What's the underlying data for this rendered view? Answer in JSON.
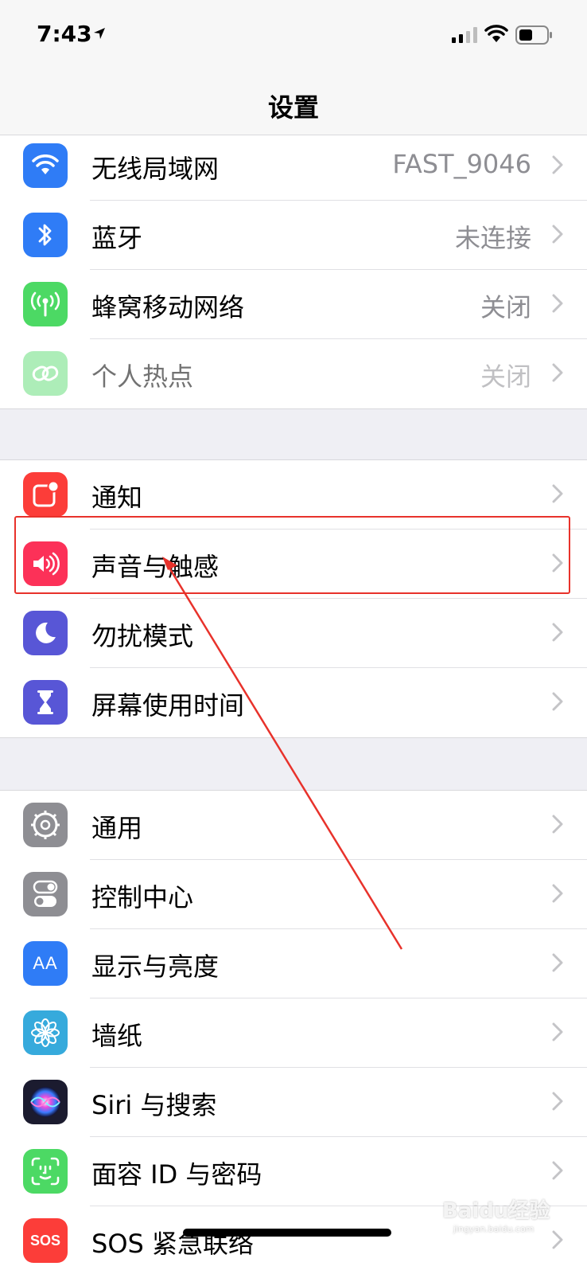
{
  "status": {
    "time": "7:43"
  },
  "nav": {
    "title": "设置"
  },
  "groups": [
    {
      "rows": [
        {
          "label": "无线局域网",
          "value": "FAST_9046",
          "icon": "wifi-icon",
          "color": "#2f7cf6"
        },
        {
          "label": "蓝牙",
          "value": "未连接",
          "icon": "bluetooth-icon",
          "color": "#2f7cf6"
        },
        {
          "label": "蜂窝移动网络",
          "value": "关闭",
          "icon": "antenna-icon",
          "color": "#4cd964"
        },
        {
          "label": "个人热点",
          "value": "关闭",
          "icon": "hotspot-link-icon",
          "color": "#4cd964"
        }
      ]
    },
    {
      "rows": [
        {
          "label": "通知",
          "icon": "notification-icon",
          "color": "#fc3d39"
        },
        {
          "label": "声音与触感",
          "icon": "speaker-icon",
          "color": "#fc3158"
        },
        {
          "label": "勿扰模式",
          "icon": "moon-icon",
          "color": "#5856d6"
        },
        {
          "label": "屏幕使用时间",
          "icon": "hourglass-icon",
          "color": "#5856d6"
        }
      ]
    },
    {
      "rows": [
        {
          "label": "通用",
          "icon": "gear-icon",
          "color": "#8e8e93"
        },
        {
          "label": "控制中心",
          "icon": "toggles-icon",
          "color": "#8e8e93"
        },
        {
          "label": "显示与亮度",
          "icon": "text-size-icon",
          "color": "#2f7cf6"
        },
        {
          "label": "墙纸",
          "icon": "flower-icon",
          "color": "#36aadc"
        },
        {
          "label": "Siri 与搜索",
          "icon": "siri-icon",
          "color": "#1b1b2f"
        },
        {
          "label": "面容 ID 与密码",
          "icon": "face-id-icon",
          "color": "#4cd964"
        },
        {
          "label": "SOS 紧急联络",
          "icon": "sos-icon",
          "color": "#fc3d39"
        }
      ]
    }
  ],
  "icons": {
    "sos_text": "SOS",
    "display_text": "AA"
  },
  "watermark": {
    "brand": "Baidu经验",
    "url": "jingyan.baidu.com"
  }
}
